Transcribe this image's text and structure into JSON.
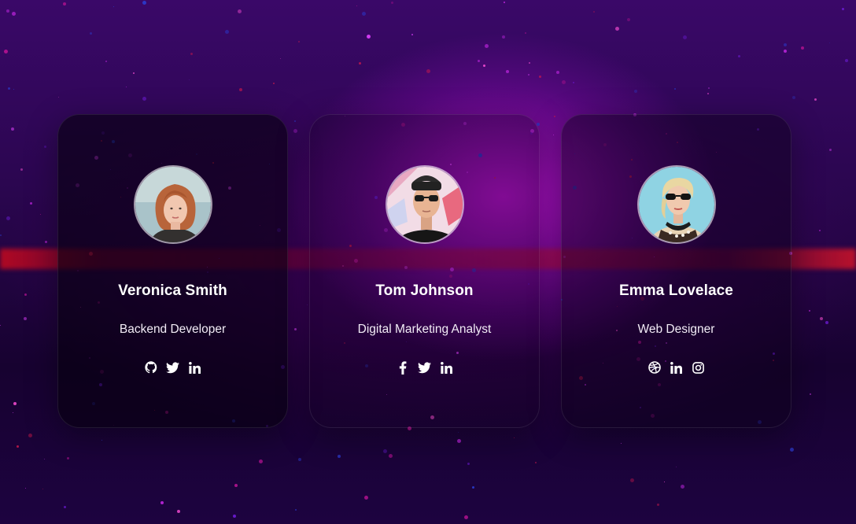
{
  "colors": {
    "accent_glow": "#c814dc",
    "background": "#2a0748",
    "text": "#ffffff"
  },
  "team": [
    {
      "name": "Veronica Smith",
      "role": "Backend Developer",
      "socials": [
        "github-icon",
        "twitter-icon",
        "linkedin-icon"
      ]
    },
    {
      "name": "Tom Johnson",
      "role": "Digital Marketing Analyst",
      "socials": [
        "facebook-icon",
        "twitter-icon",
        "linkedin-icon"
      ]
    },
    {
      "name": "Emma Lovelace",
      "role": "Web Designer",
      "socials": [
        "dribbble-icon",
        "linkedin-icon",
        "instagram-icon"
      ]
    }
  ]
}
